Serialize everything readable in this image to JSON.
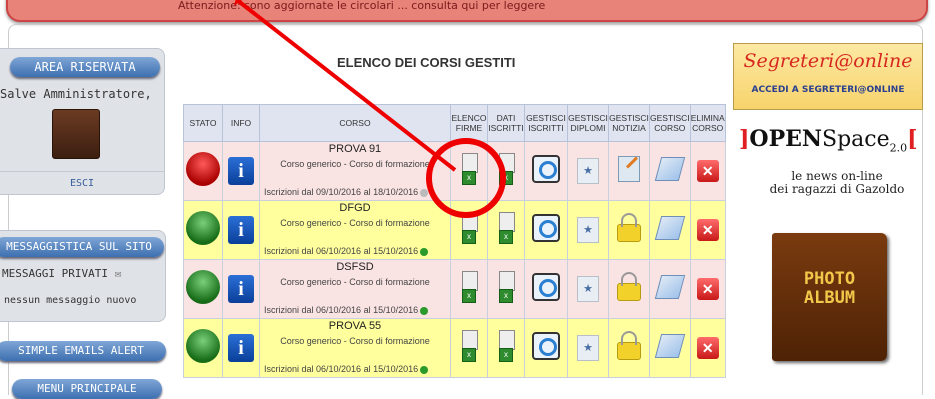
{
  "banner": {
    "text": "Attenzione: sono aggiornate le circolari ... consulta qui per leggere"
  },
  "sidebar": {
    "area_title": "AREA RISERVATA",
    "greeting": "Salve Amministratore,",
    "logout": "ESCI",
    "messages_title": "MESSAGGISTICA SUL SITO",
    "private_label": "MESSAGGI PRIVATI",
    "no_messages": "nessun messaggio nuovo",
    "email_title": "SIMPLE EMAILS ALERT",
    "menu_title": "MENU PRINCIPALE"
  },
  "main": {
    "title": "ELENCO DEI CORSI GESTITI",
    "headers": [
      "STATO",
      "INFO",
      "CORSO",
      "ELENCO FIRME",
      "DATI ISCRITTI",
      "GESTISCI ISCRITTI",
      "GESTISCI DIPLOMI",
      "GESTISCI NOTIZIA",
      "GESTISCI CORSO",
      "ELIMINA CORSO"
    ],
    "rows": [
      {
        "name": "PROVA 91",
        "desc": "Corso generico - Corso di formazione",
        "dates": "Iscrizioni dal 09/10/2016 al 18/10/2016",
        "status": "red"
      },
      {
        "name": "DFGD",
        "desc": "Corso generico - Corso di formazione",
        "dates": "Iscrizioni dal 06/10/2016 al 15/10/2016",
        "status": "green"
      },
      {
        "name": "DSFSD",
        "desc": "Corso generico - Corso di formazione",
        "dates": "Iscrizioni dal 06/10/2016 al 15/10/2016",
        "status": "green"
      },
      {
        "name": "PROVA 55",
        "desc": "Corso generico - Corso di formazione",
        "dates": "Iscrizioni dal 06/10/2016 al 15/10/2016",
        "status": "green"
      }
    ]
  },
  "right": {
    "segreteria_title": "Segreteri@online",
    "segreteria_link": "ACCEDI A SEGRETERI@ONLINE",
    "openspace_left": "]",
    "openspace_brand": "OPEN",
    "openspace_word": "Space",
    "openspace_version": "2.0",
    "openspace_right": "[",
    "openspace_line1": "le news on-line",
    "openspace_line2": "dei ragazzi di Gazoldo",
    "album_line1": "PHOTO",
    "album_line2": "ALBUM"
  },
  "colors": {
    "annotation": "#e00000",
    "pink_row": "#fae3e3",
    "yellow_row": "#ffff9e"
  }
}
